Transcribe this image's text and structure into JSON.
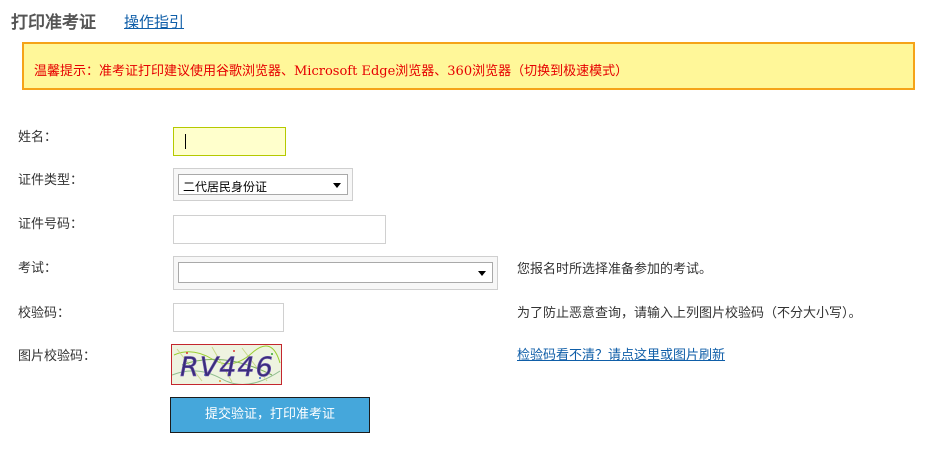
{
  "header": {
    "title": "打印准考证",
    "guide_link": "操作指引"
  },
  "notice": {
    "text": "温馨提示：准考证打印建议使用谷歌浏览器、Microsoft Edge浏览器、360浏览器（切换到极速模式）"
  },
  "form": {
    "name_label": "姓名：",
    "name_value": "",
    "id_type_label": "证件类型：",
    "id_type_selected": "二代居民身份证",
    "id_number_label": "证件号码：",
    "id_number_value": "",
    "exam_label": "考试：",
    "exam_selected": "",
    "exam_hint": "您报名时所选择准备参加的考试。",
    "verify_label": "校验码：",
    "verify_value": "",
    "verify_hint": "为了防止恶意查询，请输入上列图片校验码（不分大小写）。",
    "captcha_label": "图片校验码：",
    "captcha_text": "RV446",
    "refresh_link": "检验码看不清？请点这里或图片刷新",
    "submit_label": "提交验证，打印准考证"
  },
  "colors": {
    "notice_bg": "#fff799",
    "notice_border": "#f5a318",
    "notice_text": "#e60000",
    "link": "#0f5ea8",
    "submit_bg": "#45a7db",
    "name_input_bg": "#ffffcc"
  }
}
